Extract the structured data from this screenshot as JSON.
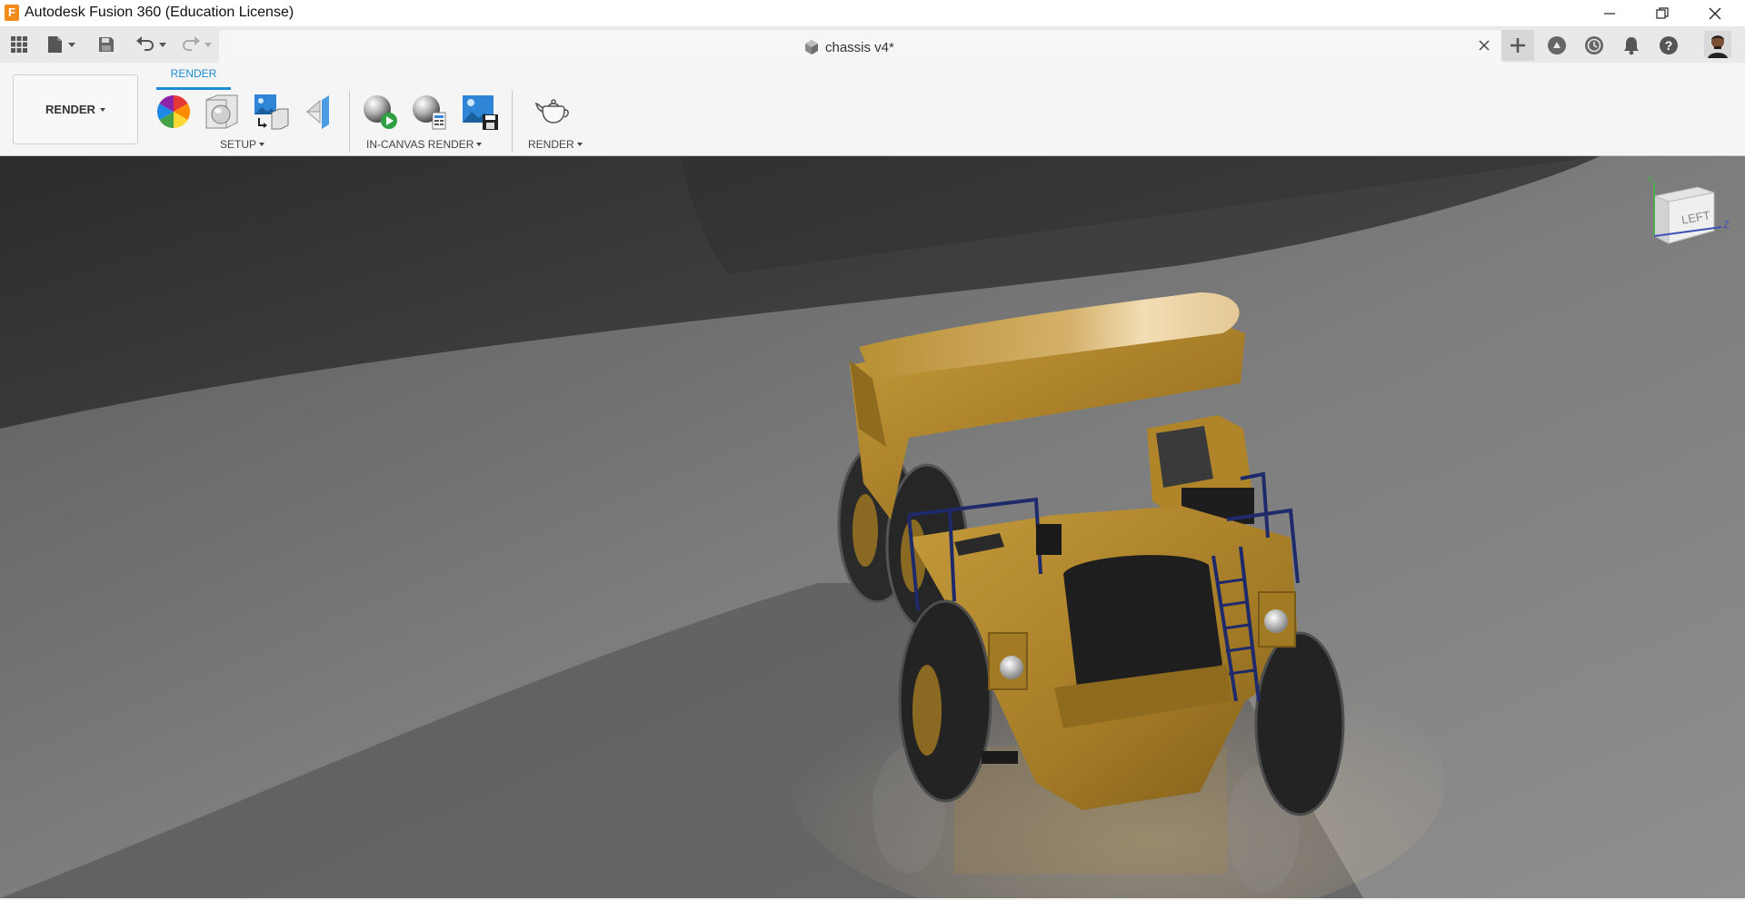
{
  "window": {
    "title": "Autodesk Fusion 360 (Education License)",
    "logo_letter": "F",
    "controls": [
      "minimize-icon",
      "restore-icon",
      "close-icon"
    ]
  },
  "quick_access": {
    "icons": [
      "grid-icon",
      "file-icon",
      "save-icon",
      "undo-icon",
      "redo-icon"
    ]
  },
  "document": {
    "title": "chassis v4*",
    "icon": "cube-icon",
    "close_icon": "close-icon"
  },
  "right_icons": [
    "plus-icon",
    "extensions-icon",
    "job-status-icon",
    "notifications-icon",
    "help-icon",
    "avatar"
  ],
  "toolbar": {
    "workspace_label": "RENDER",
    "active_tab": "RENDER",
    "groups": [
      {
        "label": "SETUP",
        "tools": [
          "appearance-icon",
          "scene-settings-icon",
          "texture-map-icon",
          "decal-icon"
        ]
      },
      {
        "label": "IN-CANVAS RENDER",
        "tools": [
          "in-canvas-render-icon",
          "in-canvas-settings-icon",
          "capture-image-icon"
        ]
      },
      {
        "label": "RENDER",
        "tools": [
          "render-teapot-icon"
        ]
      }
    ]
  },
  "viewcube": {
    "face_label": "LEFT",
    "axis_y": "Y",
    "axis_z": "Z"
  },
  "colors": {
    "accent": "#1c8bd6",
    "truck_body": "#b8902e",
    "tire": "#2a2a2a",
    "railing": "#1f2a6b"
  }
}
